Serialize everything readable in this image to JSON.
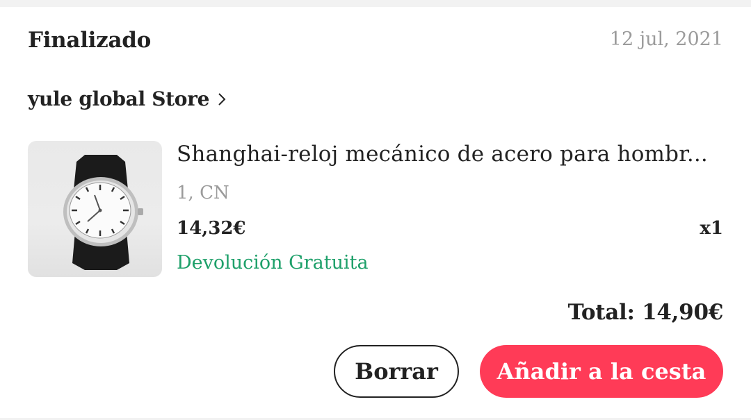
{
  "order": {
    "status": "Finalizado",
    "date": "12 jul, 2021",
    "store_name": "yule global Store"
  },
  "item": {
    "title": "Shanghai-reloj mecánico de acero para hombr...",
    "variant": "1, CN",
    "price": "14,32€",
    "quantity": "x1",
    "free_return": "Devolución Gratuita"
  },
  "summary": {
    "total": "Total: 14,90€"
  },
  "actions": {
    "delete_label": "Borrar",
    "add_to_cart_label": "Añadir a la cesta"
  },
  "colors": {
    "accent": "#ff3b57",
    "success": "#1ea06a",
    "muted": "#9b9b9b"
  }
}
